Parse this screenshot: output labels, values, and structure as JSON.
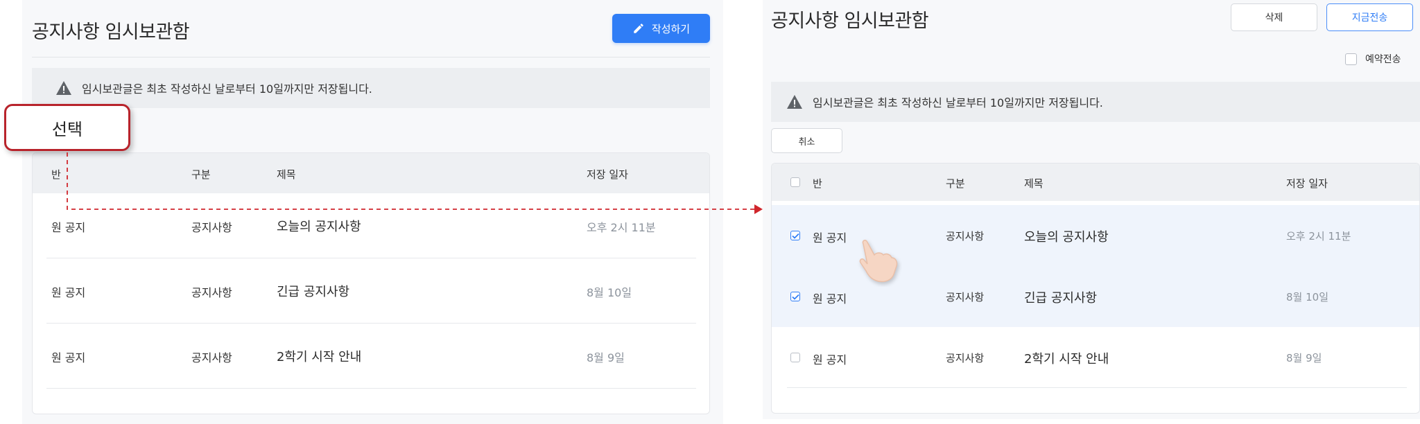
{
  "left": {
    "title": "공지사항 임시보관함",
    "write_button": "작성하기",
    "notice": "임시보관글은 최초 작성하신 날로부터 10일까지만 저장됩니다.",
    "callout": "선택",
    "headers": [
      "반",
      "구분",
      "제목",
      "저장 일자"
    ],
    "rows": [
      {
        "class": "원 공지",
        "category": "공지사항",
        "title": "오늘의 공지사항",
        "date": "오후 2시 11분"
      },
      {
        "class": "원 공지",
        "category": "공지사항",
        "title": "긴급 공지사항",
        "date": "8월 10일"
      },
      {
        "class": "원 공지",
        "category": "공지사항",
        "title": "2학기 시작 안내",
        "date": "8월 9일"
      }
    ]
  },
  "right": {
    "title": "공지사항 임시보관함",
    "delete_button": "삭제",
    "send_now_button": "지금전송",
    "reserve_label": "예약전송",
    "notice": "임시보관글은 최초 작성하신 날로부터 10일까지만 저장됩니다.",
    "cancel_button": "취소",
    "headers": [
      "반",
      "구분",
      "제목",
      "저장 일자"
    ],
    "rows": [
      {
        "class": "원 공지",
        "category": "공지사항",
        "title": "오늘의 공지사항",
        "date": "오후 2시 11분",
        "checked": true
      },
      {
        "class": "원 공지",
        "category": "공지사항",
        "title": "긴급 공지사항",
        "date": "8월 10일",
        "checked": true
      },
      {
        "class": "원 공지",
        "category": "공지사항",
        "title": "2학기 시작 안내",
        "date": "8월 9일",
        "checked": false
      }
    ]
  },
  "colors": {
    "accent": "#2f7df6",
    "callout_border": "#b8232b",
    "arrow": "#d0262c",
    "selected_row": "#eff4fc"
  },
  "icons": {
    "write": "pencil-icon",
    "warning": "warning-triangle-icon",
    "pointer": "hand-pointer-icon",
    "arrow": "dashed-arrow-icon"
  }
}
